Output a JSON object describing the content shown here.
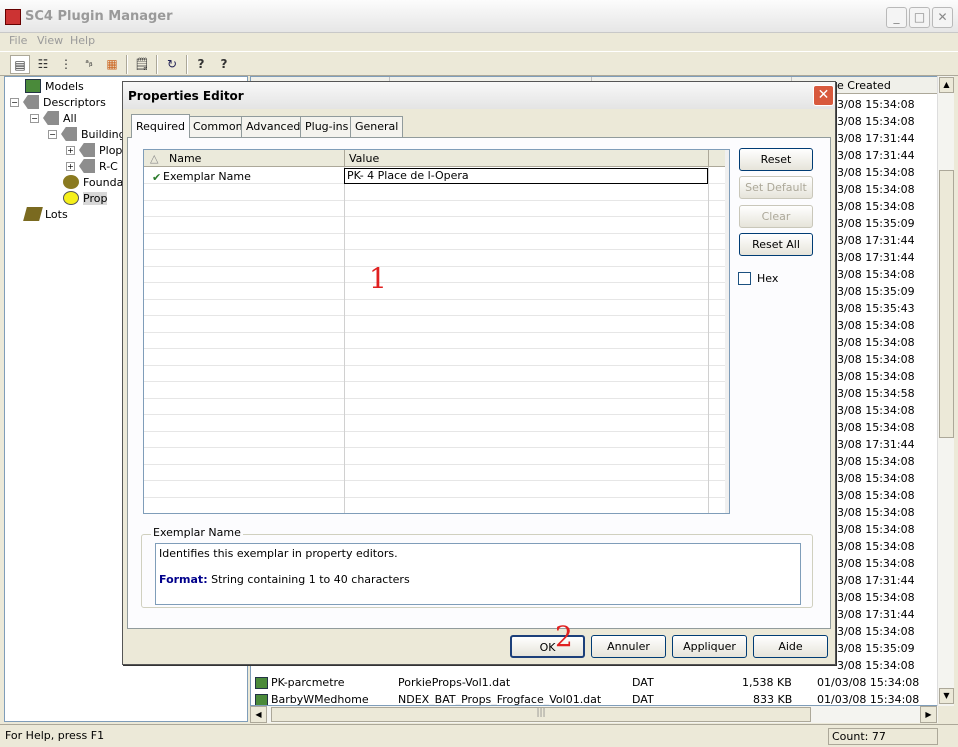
{
  "app": {
    "title": "SC4 Plugin Manager",
    "window_buttons": {
      "minimize": "_",
      "maximize": "□",
      "close": "✕"
    }
  },
  "menu": [
    "File",
    "View",
    "Help"
  ],
  "toolbar": {
    "buttons": [
      "details-view",
      "list-view",
      "tree-view",
      "small-icons-view",
      "color-grid",
      "properties",
      "refresh",
      "help",
      "context-help"
    ],
    "glyphs": [
      "▤",
      "☷",
      "⋮",
      "ᵃᵦ",
      "▦",
      "🗒",
      "↻",
      "?",
      "?"
    ]
  },
  "tree": [
    {
      "label": "Models",
      "icon": "model-icon"
    },
    {
      "label": "Descriptors",
      "icon": "descriptor-icon",
      "expander": "−"
    },
    {
      "label": "All",
      "icon": "descriptor-icon",
      "expander": "−"
    },
    {
      "label": "Building",
      "icon": "descriptor-icon",
      "expander": "−"
    },
    {
      "label": "Plop",
      "icon": "descriptor-icon",
      "expander": "+"
    },
    {
      "label": "R-C",
      "icon": "descriptor-icon",
      "expander": "+"
    },
    {
      "label": "Foundat",
      "icon": "foundation-icon"
    },
    {
      "label": "Prop",
      "icon": "prop-icon",
      "selected": true
    },
    {
      "label": "Lots",
      "icon": "lot-icon"
    }
  ],
  "list": {
    "date_header": "e Created",
    "timestamps": [
      "3/08 15:34:08",
      "3/08 15:34:08",
      "3/08 17:31:44",
      "3/08 17:31:44",
      "3/08 15:34:08",
      "3/08 15:34:08",
      "3/08 15:34:08",
      "3/08 15:35:09",
      "3/08 17:31:44",
      "3/08 17:31:44",
      "3/08 15:34:08",
      "3/08 15:35:09",
      "3/08 15:35:43",
      "3/08 15:34:08",
      "3/08 15:34:08",
      "3/08 15:34:08",
      "3/08 15:34:08",
      "3/08 15:34:58",
      "3/08 15:34:08",
      "3/08 15:34:08",
      "3/08 17:31:44",
      "3/08 15:34:08",
      "3/08 15:34:08",
      "3/08 15:34:08",
      "3/08 15:34:08",
      "3/08 15:34:08",
      "3/08 15:34:08",
      "3/08 15:34:08",
      "3/08 17:31:44",
      "3/08 15:34:08",
      "3/08 17:31:44",
      "3/08 15:34:08",
      "3/08 15:35:09",
      "3/08 15:34:08"
    ],
    "rows": [
      {
        "name": "PK-parcmetre",
        "file": "PorkieProps-Vol1.dat",
        "type": "DAT",
        "size": "1,538 KB",
        "created": "01/03/08 15:34:08"
      },
      {
        "name": "BarbyWMedhome",
        "file": "NDEX_BAT_Props_Frogface_Vol01.dat",
        "type": "DAT",
        "size": "833 KB",
        "created": "01/03/08 15:34:08"
      }
    ],
    "hscroll_grip": "|||"
  },
  "status": {
    "help": "For Help, press F1",
    "count": "Count: 77"
  },
  "dialog": {
    "title": "Properties Editor",
    "close": "✕",
    "tabs": [
      "Required",
      "Common",
      "Advanced",
      "Plug-ins",
      "General"
    ],
    "active_tab": "Required",
    "grid": {
      "sort_indicator": "△",
      "col_name": "Name",
      "col_value": "Value",
      "row_check": "✔",
      "row_name": "Exemplar Name",
      "row_value": "PK- 4 Place de l-Opera"
    },
    "buttons": {
      "reset": "Reset",
      "set_default": "Set Default",
      "clear": "Clear",
      "reset_all": "Reset All",
      "hex": "Hex",
      "ok": "OK",
      "cancel": "Annuler",
      "apply": "Appliquer",
      "help": "Aide"
    },
    "description": {
      "legend": "Exemplar Name",
      "text": "Identifies this exemplar in property editors.",
      "format_label": "Format:",
      "format_text": " String containing 1 to 40 characters"
    },
    "annotations": {
      "mark1": "1",
      "mark2": "2"
    }
  }
}
